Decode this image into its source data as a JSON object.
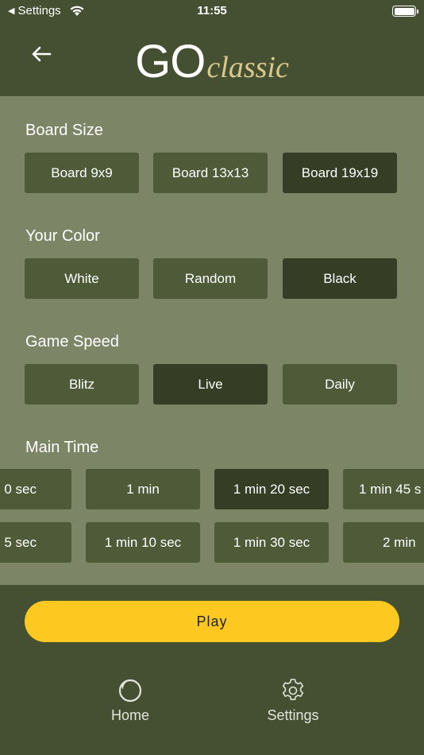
{
  "status_bar": {
    "back_app": "Settings",
    "time": "11:55"
  },
  "header": {
    "logo_main": "GO",
    "logo_sub": "classic"
  },
  "sections": {
    "board_size": {
      "title": "Board Size",
      "options": [
        "Board 9x9",
        "Board 13x13",
        "Board 19x19"
      ],
      "selected": "Board 19x19"
    },
    "your_color": {
      "title": "Your Color",
      "options": [
        "White",
        "Random",
        "Black"
      ],
      "selected": "Black"
    },
    "game_speed": {
      "title": "Game Speed",
      "options": [
        "Blitz",
        "Live",
        "Daily"
      ],
      "selected": "Live"
    },
    "main_time": {
      "title": "Main Time",
      "row1": [
        "0 sec",
        "1 min",
        "1 min 20 sec",
        "1 min 45 s"
      ],
      "row2": [
        "5 sec",
        "1 min 10 sec",
        "1 min 30 sec",
        "2 min"
      ],
      "selected": "1 min 20 sec"
    }
  },
  "play": {
    "label": "Play"
  },
  "tabbar": {
    "home": "Home",
    "settings": "Settings"
  },
  "colors": {
    "header_bg": "#454f31",
    "content_bg": "#7c8666",
    "option_bg": "#4e5a38",
    "option_selected_bg": "#353d25",
    "play_bg": "#fdc921",
    "logo_accent": "#d9c98c"
  }
}
